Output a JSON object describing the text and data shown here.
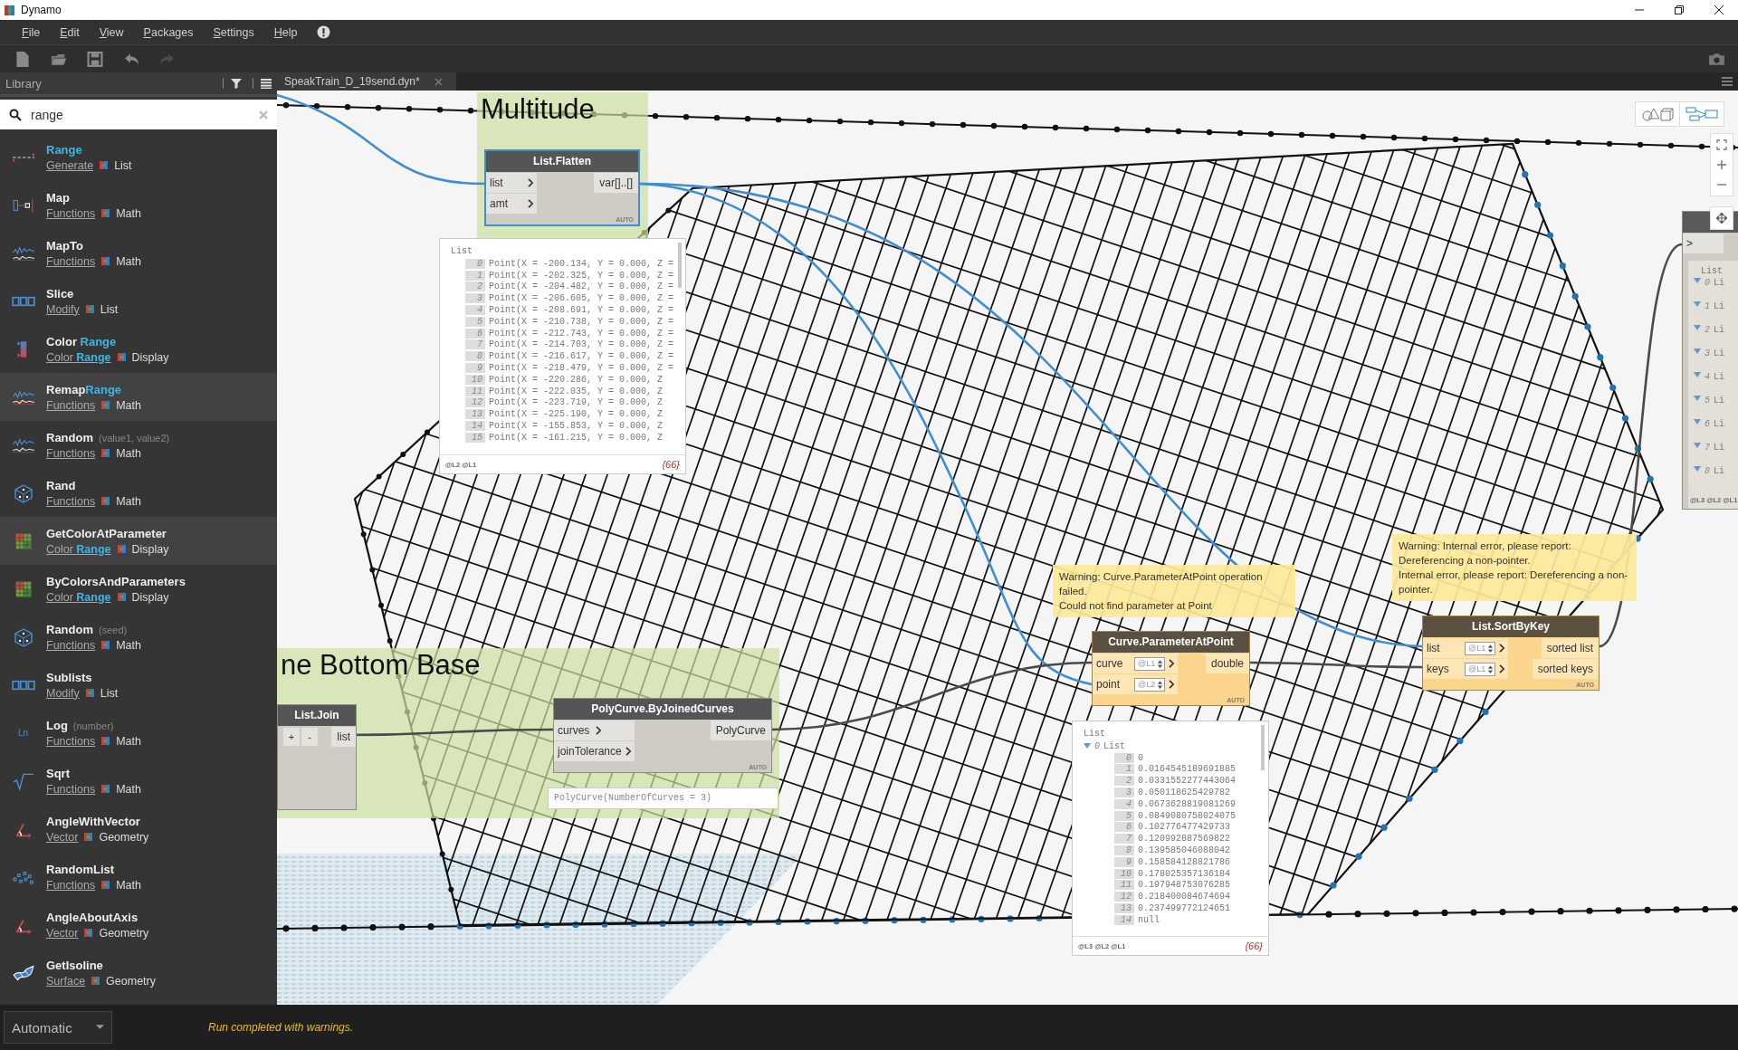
{
  "window": {
    "title": "Dynamo"
  },
  "menu": [
    "File",
    "Edit",
    "View",
    "Packages",
    "Settings",
    "Help"
  ],
  "toolbar": [
    {
      "kind": "new",
      "disabled": false
    },
    {
      "kind": "open",
      "disabled": false
    },
    {
      "kind": "save",
      "disabled": false
    },
    {
      "kind": "undo",
      "disabled": false
    },
    {
      "kind": "redo",
      "disabled": true
    }
  ],
  "library": {
    "title": "Library",
    "search": {
      "value": "range"
    },
    "items": [
      {
        "name": "Range",
        "matched": true,
        "category": "Generate",
        "group": "List",
        "selected": false
      },
      {
        "name": "Map",
        "matched": false,
        "category": "Functions",
        "group": "Math",
        "selected": false
      },
      {
        "name": "MapTo",
        "matched": false,
        "category": "Functions",
        "group": "Math",
        "selected": false
      },
      {
        "name": "Slice",
        "matched": false,
        "category": "Modify",
        "group": "List",
        "selected": false
      },
      {
        "name": "Color **Range**",
        "matched": false,
        "category": "Color **Range**",
        "group": "Display",
        "selected": false
      },
      {
        "name": "Remap**Range**",
        "matched": false,
        "category": "Functions",
        "group": "Math",
        "selected": true
      },
      {
        "name": "Random",
        "matched": false,
        "hint": "(value1, value2)",
        "category": "Functions",
        "group": "Math",
        "selected": false
      },
      {
        "name": "Rand",
        "matched": false,
        "category": "Functions",
        "group": "Math",
        "selected": false
      },
      {
        "name": "GetColorAtParameter",
        "matched": false,
        "category": "Color **Range**",
        "group": "Display",
        "selected": true
      },
      {
        "name": "ByColorsAndParameters",
        "matched": false,
        "category": "Color **Range**",
        "group": "Display",
        "selected": false
      },
      {
        "name": "Random",
        "matched": false,
        "hint": "(seed)",
        "category": "Functions",
        "group": "Math",
        "selected": false
      },
      {
        "name": "Sublists",
        "matched": false,
        "category": "Modify",
        "group": "List",
        "selected": false
      },
      {
        "name": "Log",
        "matched": false,
        "hint": "(number)",
        "icon_text": "Ln",
        "category": "Functions",
        "group": "Math",
        "selected": false
      },
      {
        "name": "Sqrt",
        "matched": false,
        "category": "Functions",
        "group": "Math",
        "selected": false
      },
      {
        "name": "AngleWithVector",
        "matched": false,
        "category": "Vector",
        "group": "Geometry",
        "selected": false
      },
      {
        "name": "RandomList",
        "matched": false,
        "category": "Functions",
        "group": "Math",
        "selected": false
      },
      {
        "name": "AngleAboutAxis",
        "matched": false,
        "category": "Vector",
        "group": "Geometry",
        "selected": false
      },
      {
        "name": "GetIsoline",
        "matched": false,
        "category": "Surface",
        "group": "Geometry",
        "selected": false
      }
    ]
  },
  "tab": {
    "title": "SpeakTrain_D_19send.dyn*"
  },
  "canvas": {
    "view_toggle": [
      {
        "selected": false
      },
      {
        "selected": true
      }
    ],
    "groups": [
      {
        "title": "Multitude"
      },
      {
        "title": "ne Bottom Base"
      }
    ],
    "nodes": [
      {
        "kind": "plain",
        "title": "List.Flatten",
        "selected": true,
        "inputs": [
          {
            "name": "list"
          },
          {
            "name": "amt"
          }
        ],
        "outputs": [
          "var[]..[]"
        ],
        "lacing": "AUTO",
        "preview": {
          "header": "List",
          "items": [
            {
              "index": "0",
              "value": "Point(X = -200.134, Y = 0.000, Z ="
            },
            {
              "index": "1",
              "value": "Point(X = -202.325, Y = 0.000, Z ="
            },
            {
              "index": "2",
              "value": "Point(X = -204.482, Y = 0.000, Z ="
            },
            {
              "index": "3",
              "value": "Point(X = -206.605, Y = 0.000, Z ="
            },
            {
              "index": "4",
              "value": "Point(X = -208.691, Y = 0.000, Z ="
            },
            {
              "index": "5",
              "value": "Point(X = -210.738, Y = 0.000, Z ="
            },
            {
              "index": "6",
              "value": "Point(X = -212.743, Y = 0.000, Z ="
            },
            {
              "index": "7",
              "value": "Point(X = -214.703, Y = 0.000, Z ="
            },
            {
              "index": "8",
              "value": "Point(X = -216.617, Y = 0.000, Z ="
            },
            {
              "index": "9",
              "value": "Point(X = -218.479, Y = 0.000, Z ="
            },
            {
              "index": "10",
              "value": "Point(X = -220.286, Y = 0.000, Z"
            },
            {
              "index": "11",
              "value": "Point(X = -222.035, Y = 0.000, Z"
            },
            {
              "index": "12",
              "value": "Point(X = -223.719, Y = 0.000, Z"
            },
            {
              "index": "13",
              "value": "Point(X = -225.190, Y = 0.000, Z"
            },
            {
              "index": "14",
              "value": "Point(X = -155.853, Y = 0.000, Z"
            },
            {
              "index": "15",
              "value": "Point(X = -161.215, Y = 0.000, Z"
            }
          ],
          "levels": "@L2 @L1",
          "count": "{66}"
        }
      },
      {
        "kind": "join",
        "title": "List.Join",
        "selected": false,
        "buttons": [
          "+",
          "-"
        ],
        "outputs": [
          "list"
        ]
      },
      {
        "kind": "plain",
        "title": "PolyCurve.ByJoinedCurves",
        "selected": false,
        "inputs": [
          {
            "name": "curves"
          },
          {
            "name": "joinTolerance"
          }
        ],
        "outputs": [
          "PolyCurve"
        ],
        "lacing": "AUTO",
        "summary": "PolyCurve(NumberOfCurves = 3)"
      },
      {
        "kind": "plain",
        "title": "Curve.ParameterAtPoint",
        "selected": false,
        "warning": "Warning: Curve.ParameterAtPoint operation failed.\nCould not find parameter at Point",
        "inputs": [
          {
            "name": "curve",
            "level": "@L1"
          },
          {
            "name": "point",
            "level": "@L2"
          }
        ],
        "outputs": [
          "double"
        ],
        "lacing": "AUTO",
        "preview": {
          "header": "List",
          "items": [
            {
              "index": "0",
              "value": "List",
              "expanded": true,
              "children": [
                {
                  "index": "0",
                  "value": "0"
                },
                {
                  "index": "1",
                  "value": "0.0164545189691885"
                },
                {
                  "index": "2",
                  "value": "0.0331552277443064"
                },
                {
                  "index": "3",
                  "value": "0.050118625429782"
                },
                {
                  "index": "4",
                  "value": "0.0673628819081269"
                },
                {
                  "index": "5",
                  "value": "0.0849080758024075"
                },
                {
                  "index": "6",
                  "value": "0.102776477429733"
                },
                {
                  "index": "7",
                  "value": "0.120992887569822"
                },
                {
                  "index": "8",
                  "value": "0.139585046088042"
                },
                {
                  "index": "9",
                  "value": "0.158584128821786"
                },
                {
                  "index": "10",
                  "value": "0.178025357136184"
                },
                {
                  "index": "11",
                  "value": "0.197948753076285"
                },
                {
                  "index": "12",
                  "value": "0.218400084674694"
                },
                {
                  "index": "13",
                  "value": "0.237499772124651"
                },
                {
                  "index": "14",
                  "value": "null"
                }
              ]
            }
          ],
          "levels": "@L3 @L2 @L1",
          "count": "{66}"
        }
      },
      {
        "kind": "plain",
        "title": "List.SortByKey",
        "selected": false,
        "warning": "Warning: Internal error, please report: Dereferencing a non-pointer.\nInternal error, please report: Dereferencing a non-pointer.",
        "inputs": [
          {
            "name": "list",
            "level": "@L1"
          },
          {
            "name": "keys",
            "level": "@L1"
          }
        ],
        "outputs": [
          "sorted list",
          "sorted keys"
        ],
        "lacing": "AUTO"
      },
      {
        "kind": "plain",
        "selected": false,
        "inputs": [
          {
            "name": ">"
          }
        ],
        "preview": {
          "header": "List",
          "items": [
            {
              "index": "0",
              "value": "Li",
              "expanded": true
            },
            {
              "index": "1",
              "value": "Li",
              "expanded": true
            },
            {
              "index": "2",
              "value": "Li",
              "expanded": true
            },
            {
              "index": "3",
              "value": "Li",
              "expanded": true
            },
            {
              "index": "4",
              "value": "Li",
              "expanded": true
            },
            {
              "index": "5",
              "value": "Li",
              "expanded": true
            },
            {
              "index": "6",
              "value": "Li",
              "expanded": true
            },
            {
              "index": "7",
              "value": "Li",
              "expanded": true
            },
            {
              "index": "8",
              "value": "Li",
              "expanded": true
            }
          ],
          "levels": "@L3 @L2 @L1"
        }
      }
    ]
  },
  "status": {
    "run_mode": "Automatic",
    "message": "Run completed with warnings."
  }
}
